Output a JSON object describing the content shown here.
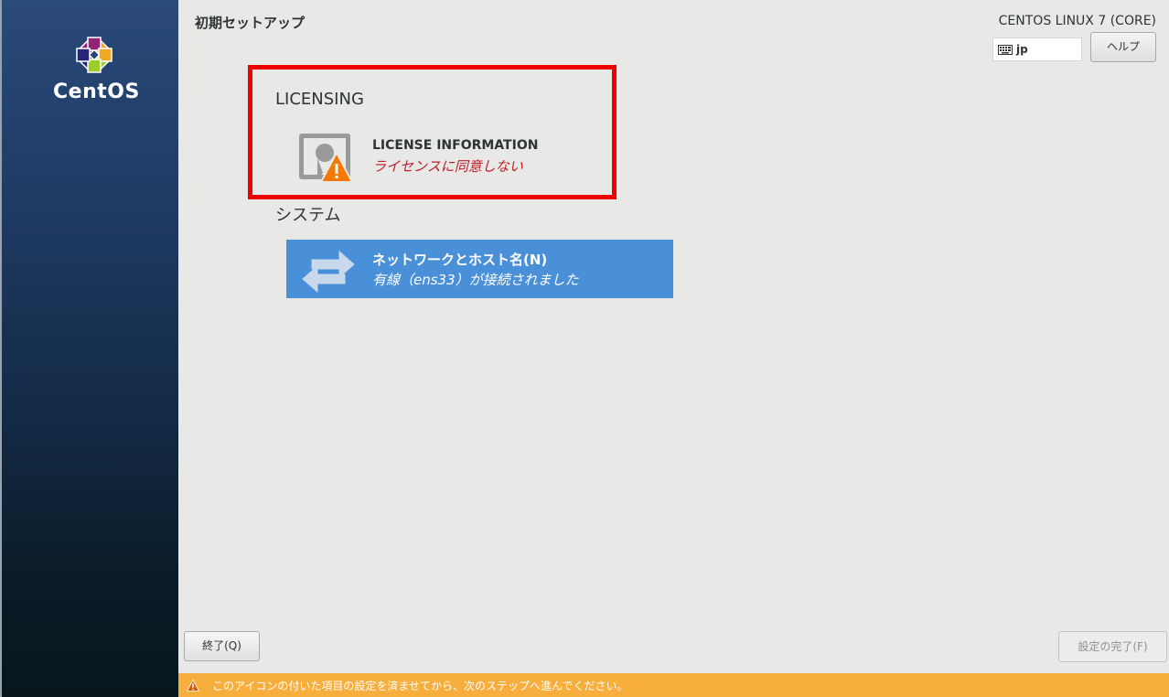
{
  "sidebar": {
    "logo_text": "CentOS"
  },
  "header": {
    "page_title": "初期セットアップ",
    "product_title": "CENTOS LINUX 7 (CORE)",
    "keyboard_layout": "jp",
    "help_label": "ヘルプ"
  },
  "sections": {
    "licensing": {
      "label": "LICENSING",
      "item": {
        "title": "LICENSE INFORMATION",
        "status": "ライセンスに同意しない",
        "icon": "license-warning-icon"
      }
    },
    "system": {
      "label": "システム",
      "item": {
        "title": "ネットワークとホスト名(N)",
        "status": "有線（ens33）が接続されました",
        "icon": "network-arrows-icon"
      }
    }
  },
  "footer": {
    "quit_label": "終了(Q)",
    "finish_label": "設定の完了(F)",
    "warning_text": "このアイコンの付いた項目の設定を済ませてから、次のステップへ進んでください。"
  },
  "colors": {
    "warning_bar": "#f8ae3c",
    "network_tile": "#4a90d9",
    "highlight_border": "#ee0000",
    "status_error": "#c01c28"
  }
}
